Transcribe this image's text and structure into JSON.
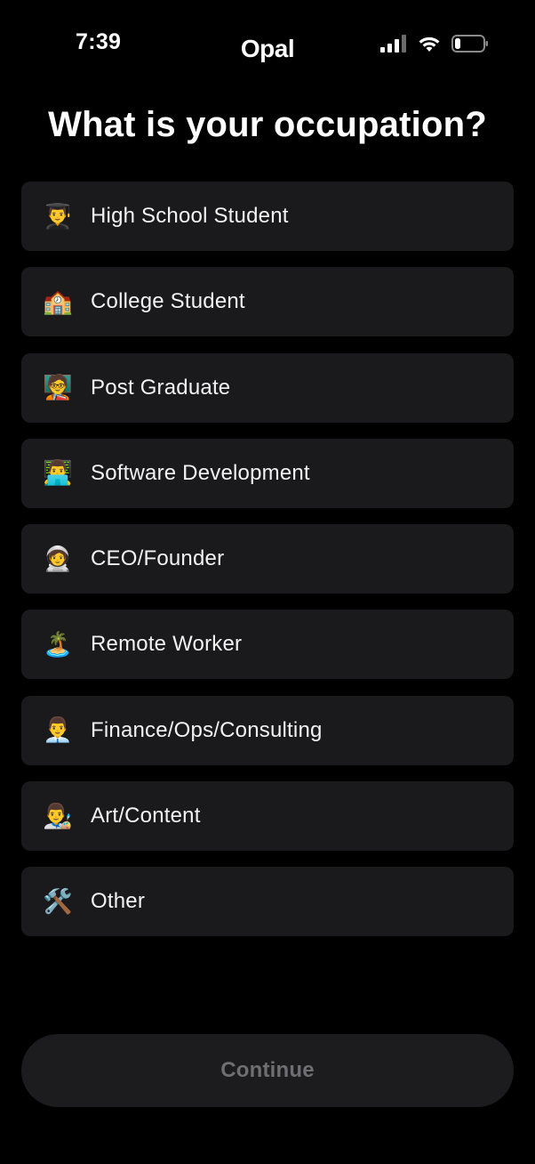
{
  "status_bar": {
    "time": "7:39",
    "brand": "Opal",
    "icons": [
      "cellular-signal-icon",
      "wifi-icon",
      "battery-icon"
    ]
  },
  "title": "What is your occupation?",
  "options": [
    {
      "emoji": "👨‍🎓",
      "label": "High School Student"
    },
    {
      "emoji": "🏫",
      "label": "College Student"
    },
    {
      "emoji": "🧑‍🏫",
      "label": "Post Graduate"
    },
    {
      "emoji": "👨‍💻",
      "label": "Software Development"
    },
    {
      "emoji": "🧑‍🚀",
      "label": "CEO/Founder"
    },
    {
      "emoji": "🏝️",
      "label": "Remote Worker"
    },
    {
      "emoji": "👨‍💼",
      "label": "Finance/Ops/Consulting"
    },
    {
      "emoji": "👨‍🎨",
      "label": "Art/Content"
    },
    {
      "emoji": "🛠️",
      "label": "Other"
    }
  ],
  "continue_label": "Continue",
  "colors": {
    "background": "#000000",
    "option_background": "#1a1a1c",
    "button_background": "#1c1c1e",
    "button_text_disabled": "#6e6e73"
  }
}
